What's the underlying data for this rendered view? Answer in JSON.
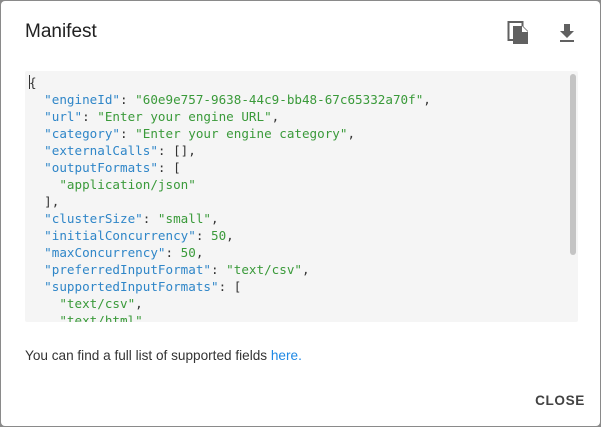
{
  "dialog": {
    "title": "Manifest",
    "icons": {
      "copy": "copy-icon",
      "download": "download-icon"
    }
  },
  "manifest": {
    "lines": [
      [
        {
          "t": "p",
          "v": "{"
        }
      ],
      [
        {
          "t": "p",
          "v": "  "
        },
        {
          "t": "k",
          "v": "\"engineId\""
        },
        {
          "t": "p",
          "v": ": "
        },
        {
          "t": "s",
          "v": "\"60e9e757-9638-44c9-bb48-67c65332a70f\""
        },
        {
          "t": "p",
          "v": ","
        }
      ],
      [
        {
          "t": "p",
          "v": "  "
        },
        {
          "t": "k",
          "v": "\"url\""
        },
        {
          "t": "p",
          "v": ": "
        },
        {
          "t": "s",
          "v": "\"Enter your engine URL\""
        },
        {
          "t": "p",
          "v": ","
        }
      ],
      [
        {
          "t": "p",
          "v": "  "
        },
        {
          "t": "k",
          "v": "\"category\""
        },
        {
          "t": "p",
          "v": ": "
        },
        {
          "t": "s",
          "v": "\"Enter your engine category\""
        },
        {
          "t": "p",
          "v": ","
        }
      ],
      [
        {
          "t": "p",
          "v": "  "
        },
        {
          "t": "k",
          "v": "\"externalCalls\""
        },
        {
          "t": "p",
          "v": ": [],"
        }
      ],
      [
        {
          "t": "p",
          "v": "  "
        },
        {
          "t": "k",
          "v": "\"outputFormats\""
        },
        {
          "t": "p",
          "v": ": ["
        }
      ],
      [
        {
          "t": "p",
          "v": "    "
        },
        {
          "t": "s",
          "v": "\"application/json\""
        }
      ],
      [
        {
          "t": "p",
          "v": "  ],"
        }
      ],
      [
        {
          "t": "p",
          "v": "  "
        },
        {
          "t": "k",
          "v": "\"clusterSize\""
        },
        {
          "t": "p",
          "v": ": "
        },
        {
          "t": "s",
          "v": "\"small\""
        },
        {
          "t": "p",
          "v": ","
        }
      ],
      [
        {
          "t": "p",
          "v": "  "
        },
        {
          "t": "k",
          "v": "\"initialConcurrency\""
        },
        {
          "t": "p",
          "v": ": "
        },
        {
          "t": "n",
          "v": "50"
        },
        {
          "t": "p",
          "v": ","
        }
      ],
      [
        {
          "t": "p",
          "v": "  "
        },
        {
          "t": "k",
          "v": "\"maxConcurrency\""
        },
        {
          "t": "p",
          "v": ": "
        },
        {
          "t": "n",
          "v": "50"
        },
        {
          "t": "p",
          "v": ","
        }
      ],
      [
        {
          "t": "p",
          "v": "  "
        },
        {
          "t": "k",
          "v": "\"preferredInputFormat\""
        },
        {
          "t": "p",
          "v": ": "
        },
        {
          "t": "s",
          "v": "\"text/csv\""
        },
        {
          "t": "p",
          "v": ","
        }
      ],
      [
        {
          "t": "p",
          "v": "  "
        },
        {
          "t": "k",
          "v": "\"supportedInputFormats\""
        },
        {
          "t": "p",
          "v": ": ["
        }
      ],
      [
        {
          "t": "p",
          "v": "    "
        },
        {
          "t": "s",
          "v": "\"text/csv\""
        },
        {
          "t": "p",
          "v": ","
        }
      ],
      [
        {
          "t": "p",
          "v": "    "
        },
        {
          "t": "s",
          "v": "\"text/html\""
        },
        {
          "t": "p",
          "v": ","
        }
      ]
    ]
  },
  "footer": {
    "text": "You can find a full list of supported fields ",
    "link_label": "here."
  },
  "actions": {
    "close_label": "CLOSE"
  }
}
